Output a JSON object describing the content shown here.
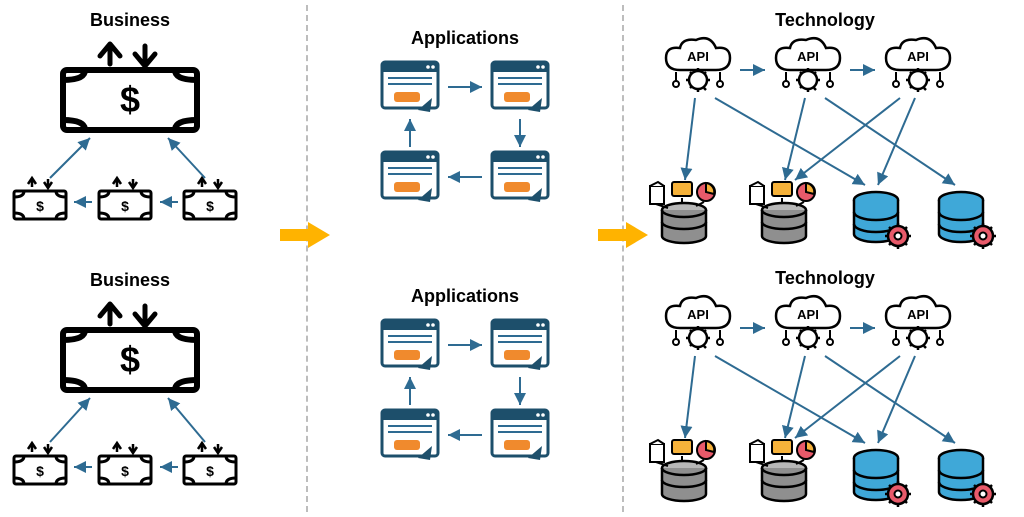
{
  "columns": {
    "business": {
      "title": "Business"
    },
    "applications": {
      "title": "Applications"
    },
    "technology": {
      "title": "Technology"
    }
  },
  "icon_labels": {
    "api": "API",
    "dollar": "$"
  },
  "layout_note": "Three-column architecture diagram: Business → Applications → Technology, each column has a top and bottom instance. Yellow arrows indicate flow between columns."
}
